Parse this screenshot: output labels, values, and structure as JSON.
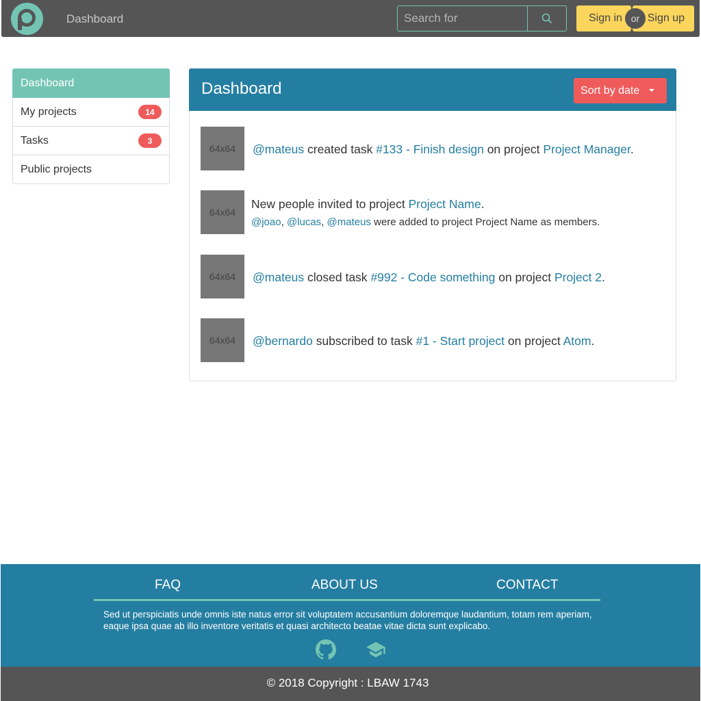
{
  "navbar": {
    "logo_icon": "p-logo-icon",
    "title": "Dashboard",
    "search_placeholder": "Search for",
    "search_icon": "search-icon",
    "signin_label": "Sign in",
    "or_label": "or",
    "signup_label": "Sign up"
  },
  "sidebar": {
    "items": [
      {
        "label": "Dashboard"
      },
      {
        "label": "My projects",
        "badge": "14"
      },
      {
        "label": "Tasks",
        "badge": "3"
      },
      {
        "label": "Public projects"
      }
    ]
  },
  "panel": {
    "title": "Dashboard",
    "sort_label": "Sort by date",
    "feed": [
      {
        "thumb": "64x64",
        "user": "@mateus",
        "action": " created task ",
        "task": "#133 - Finish design",
        "mid": " on project ",
        "project": "Project Manager",
        "end": "."
      },
      {
        "thumb": "64x64",
        "text": "New people invited to project ",
        "project": "Project Name",
        "end": ".",
        "users": [
          "@joao",
          "@lucas",
          "@mateus"
        ],
        "sep": ", ",
        "sub_text": " were added to project Project Name as members."
      },
      {
        "thumb": "64x64",
        "user": "@mateus",
        "action": " closed task ",
        "task": "#992 - Code something",
        "mid": " on project ",
        "project": "Project 2",
        "end": "."
      },
      {
        "thumb": "64x64",
        "user": "@bernardo",
        "action": " subscribed to task ",
        "task": "#1 - Start project",
        "mid": " on project ",
        "project": "Atom",
        "end": "."
      }
    ]
  },
  "footer": {
    "links": [
      "FAQ",
      "ABOUT US",
      "CONTACT"
    ],
    "text": "Sed ut perspiciatis unde omnis iste natus error sit voluptatem accusantium doloremque laudantium, totam rem aperiam, eaque ipsa quae ab illo inventore veritatis et quasi architecto beatae vitae dicta sunt explicabo.",
    "icons": [
      "github-icon",
      "graduation-cap-icon"
    ],
    "copyright": "© 2018 Copyright : LBAW 1743"
  },
  "colors": {
    "navbar": "#555555",
    "teal": "#74c4b4",
    "blue": "#247ea1",
    "red": "#ef5b5b",
    "yellow": "#fbd55c"
  }
}
